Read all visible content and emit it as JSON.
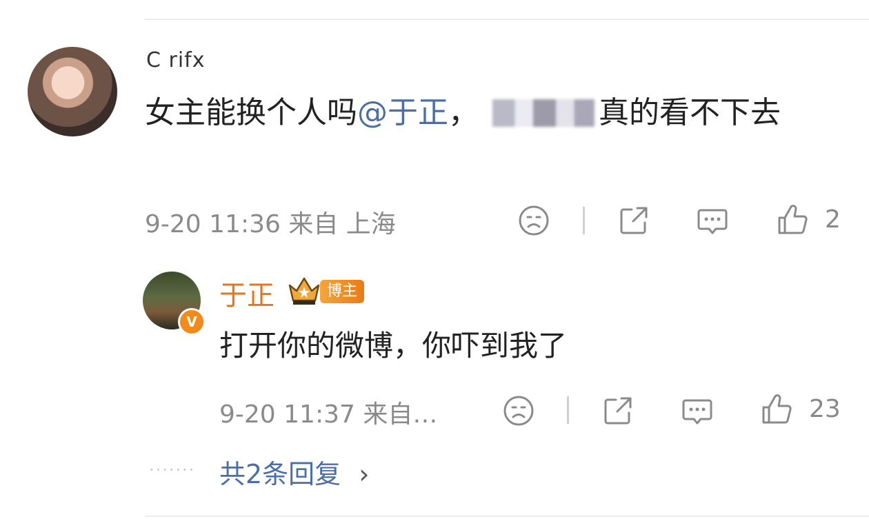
{
  "comment": {
    "username": "C rifx",
    "text_before": "女主能换个人吗",
    "mention": "@于正",
    "text_after_mention": "，",
    "text_after_blur": "真的看不下去",
    "time": "9-20 11:36",
    "location": "来自 上海",
    "like_count": "2"
  },
  "reply": {
    "username": "于正",
    "badge": "博主",
    "verified_mark": "V",
    "text": "打开你的微博，你吓到我了",
    "time": "9-20 11:37",
    "location": "来自…",
    "like_count": "23"
  },
  "more_replies": {
    "dots": "·······",
    "label": "共2条回复",
    "chevron": "›"
  },
  "icons": [
    "sad-face-icon",
    "share-icon",
    "comment-icon",
    "thumbs-up-icon",
    "crown-icon",
    "verified-badge-icon"
  ],
  "colors": {
    "mention": "#4b6ea8",
    "author_name": "#e3761f",
    "badge": "#ef8c2a",
    "meta": "#8a8a8a"
  }
}
